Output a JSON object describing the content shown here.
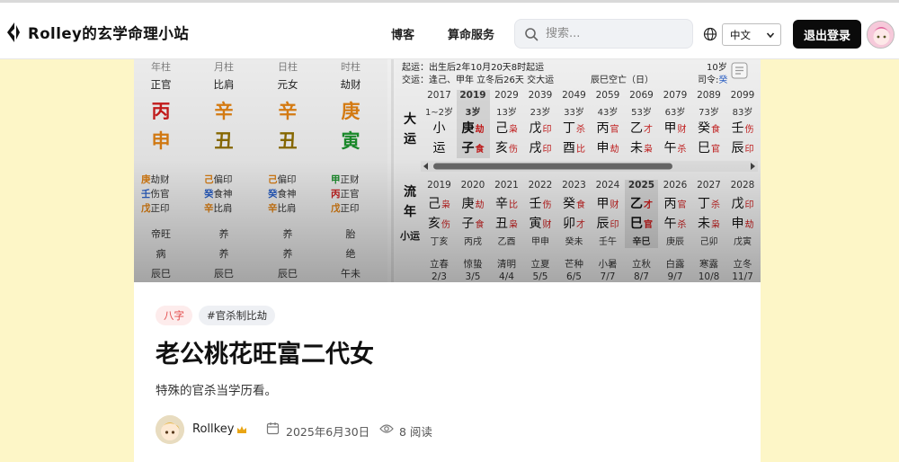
{
  "header": {
    "site_title": "Rolley的玄学命理小站",
    "nav": [
      "博客",
      "算命服务"
    ],
    "search_placeholder": "搜索...",
    "language": "中文",
    "logout_label": "退出登录"
  },
  "chart": {
    "pillars": [
      {
        "head": "年柱",
        "shishen": "正官",
        "gan": "丙",
        "zhi": "申",
        "gan_color": "#c61b1b",
        "zhi_color": "#d97d12",
        "hidden": [
          {
            "g": "庚",
            "t": "劫财"
          },
          {
            "g": "壬",
            "t": "伤官"
          },
          {
            "g": "戊",
            "t": "正印"
          }
        ],
        "bottom": [
          "帝旺",
          "病",
          "辰巳"
        ]
      },
      {
        "head": "月柱",
        "shishen": "比肩",
        "gan": "辛",
        "zhi": "丑",
        "gan_color": "#d97d12",
        "zhi_color": "#8b6b00",
        "hidden": [
          {
            "g": "己",
            "t": "偏印"
          },
          {
            "g": "癸",
            "t": "食神"
          },
          {
            "g": "辛",
            "t": "比肩"
          }
        ],
        "bottom": [
          "养",
          "养",
          "辰巳"
        ]
      },
      {
        "head": "日柱",
        "shishen": "元女",
        "gan": "辛",
        "zhi": "丑",
        "gan_color": "#d97d12",
        "zhi_color": "#8b6b00",
        "hidden": [
          {
            "g": "己",
            "t": "偏印"
          },
          {
            "g": "癸",
            "t": "食神"
          },
          {
            "g": "辛",
            "t": "比肩"
          }
        ],
        "bottom": [
          "养",
          "养",
          "辰巳"
        ]
      },
      {
        "head": "时柱",
        "shishen": "劫财",
        "gan": "庚",
        "zhi": "寅",
        "gan_color": "#d97d12",
        "zhi_color": "#1b8e2c",
        "hidden": [
          {
            "g": "甲",
            "t": "正财"
          },
          {
            "g": "丙",
            "t": "正官"
          },
          {
            "g": "戊",
            "t": "正印"
          }
        ],
        "bottom": [
          "胎",
          "绝",
          "午未"
        ]
      }
    ],
    "info_line1": "起运：出生后2年10月20天8时起运",
    "info_line1_right": "10岁",
    "info_line2": "交运：逢己、甲年 立冬后26天 交大运",
    "info_line2_mid": "辰巳空亡（日）",
    "info_line2_right": "司令:",
    "info_line2_right_val": "癸",
    "dayun_label": [
      "大",
      "运"
    ],
    "liunian_label": [
      "流",
      "年"
    ],
    "xiaoyun_label": "小运",
    "dayun": [
      {
        "year": "2017",
        "age": "1~2岁",
        "g": "小",
        "gs": "",
        "z": "运",
        "zs": ""
      },
      {
        "year": "2019",
        "age": "3岁",
        "g": "庚",
        "gs": "劫",
        "z": "子",
        "zs": "食"
      },
      {
        "year": "2029",
        "age": "13岁",
        "g": "己",
        "gs": "枭",
        "z": "亥",
        "zs": "伤"
      },
      {
        "year": "2039",
        "age": "23岁",
        "g": "戊",
        "gs": "印",
        "z": "戌",
        "zs": "印"
      },
      {
        "year": "2049",
        "age": "33岁",
        "g": "丁",
        "gs": "杀",
        "z": "酉",
        "zs": "比"
      },
      {
        "year": "2059",
        "age": "43岁",
        "g": "丙",
        "gs": "官",
        "z": "申",
        "zs": "劫"
      },
      {
        "year": "2069",
        "age": "53岁",
        "g": "乙",
        "gs": "才",
        "z": "未",
        "zs": "枭"
      },
      {
        "year": "2079",
        "age": "63岁",
        "g": "甲",
        "gs": "财",
        "z": "午",
        "zs": "杀"
      },
      {
        "year": "2089",
        "age": "73岁",
        "g": "癸",
        "gs": "食",
        "z": "巳",
        "zs": "官"
      },
      {
        "year": "2099",
        "age": "83岁",
        "g": "壬",
        "gs": "伤",
        "z": "辰",
        "zs": "印"
      }
    ],
    "liunian": [
      {
        "year": "2019",
        "g": "己",
        "gs": "枭",
        "z": "亥",
        "zs": "伤",
        "xy": "丁亥"
      },
      {
        "year": "2020",
        "g": "庚",
        "gs": "劫",
        "z": "子",
        "zs": "食",
        "xy": "丙戌"
      },
      {
        "year": "2021",
        "g": "辛",
        "gs": "比",
        "z": "丑",
        "zs": "枭",
        "xy": "乙酉"
      },
      {
        "year": "2022",
        "g": "壬",
        "gs": "伤",
        "z": "寅",
        "zs": "财",
        "xy": "甲申"
      },
      {
        "year": "2023",
        "g": "癸",
        "gs": "食",
        "z": "卯",
        "zs": "才",
        "xy": "癸未"
      },
      {
        "year": "2024",
        "g": "甲",
        "gs": "财",
        "z": "辰",
        "zs": "印",
        "xy": "壬午"
      },
      {
        "year": "2025",
        "g": "乙",
        "gs": "才",
        "z": "巳",
        "zs": "官",
        "xy": "辛巳"
      },
      {
        "year": "2026",
        "g": "丙",
        "gs": "官",
        "z": "午",
        "zs": "杀",
        "xy": "庚辰"
      },
      {
        "year": "2027",
        "g": "丁",
        "gs": "杀",
        "z": "未",
        "zs": "枭",
        "xy": "己卯"
      },
      {
        "year": "2028",
        "g": "戊",
        "gs": "印",
        "z": "申",
        "zs": "劫",
        "xy": "戊寅"
      }
    ],
    "jieqi": [
      {
        "name": "立春",
        "date": "2/3"
      },
      {
        "name": "惊蛰",
        "date": "3/5"
      },
      {
        "name": "清明",
        "date": "4/4"
      },
      {
        "name": "立夏",
        "date": "5/5"
      },
      {
        "name": "芒种",
        "date": "6/5"
      },
      {
        "name": "小暑",
        "date": "7/7"
      },
      {
        "name": "立秋",
        "date": "8/7"
      },
      {
        "name": "白露",
        "date": "9/7"
      },
      {
        "name": "寒露",
        "date": "10/8"
      },
      {
        "name": "立冬",
        "date": "11/7"
      }
    ]
  },
  "post": {
    "tags": [
      "八字",
      "#官杀制比劫"
    ],
    "title": "老公桃花旺富二代女",
    "subtitle": "特殊的官杀当学历看。",
    "author": "Rollkey",
    "date": "2025年6月30日",
    "reads": "8 阅读"
  },
  "colors": {
    "page_bg": "#fdf6c7",
    "logout_bg": "#0b0b0b",
    "tag_red_bg": "#fdecec",
    "tag_red_text": "#e34b4b"
  }
}
